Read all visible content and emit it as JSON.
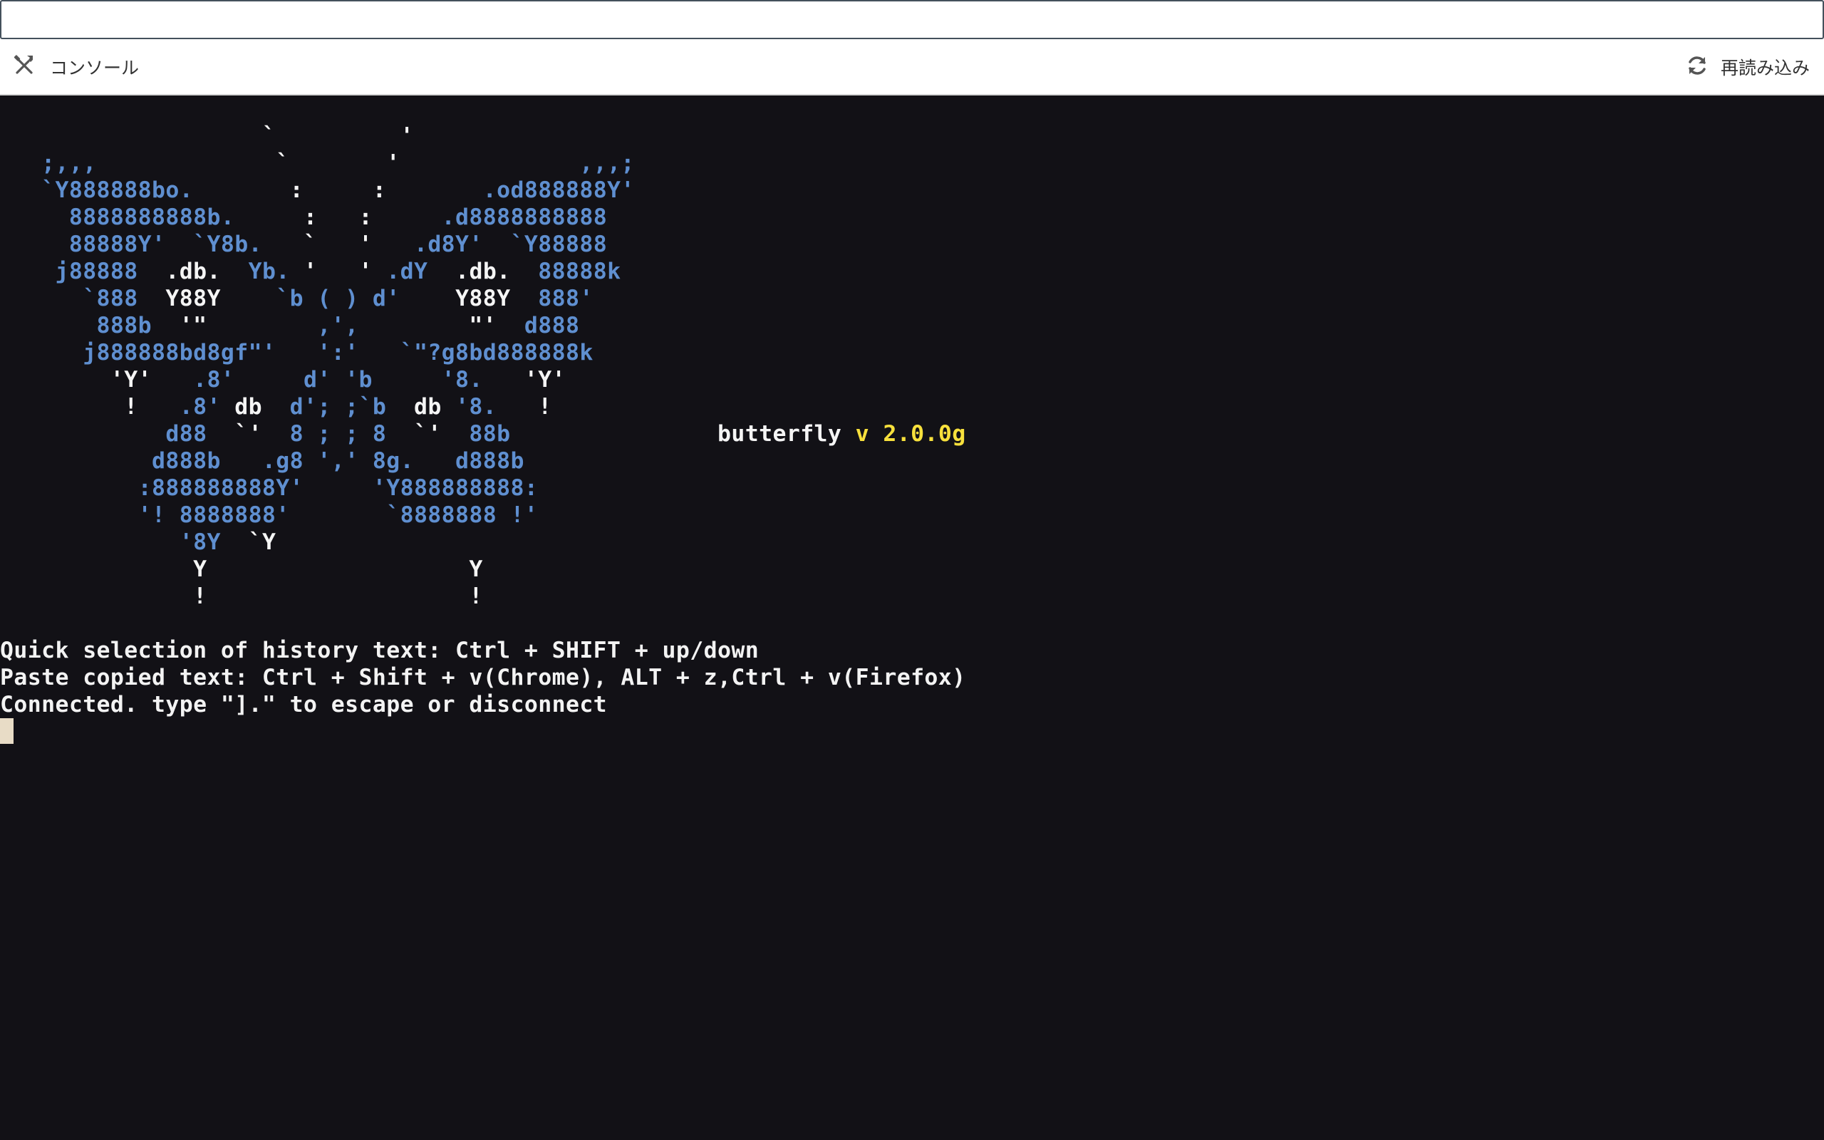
{
  "command_input": {
    "value": "",
    "placeholder": ""
  },
  "toolbar": {
    "console_label": "コンソール",
    "console_icon": "tools-icon",
    "reload_label": "再読み込み",
    "reload_icon": "refresh-icon"
  },
  "terminal": {
    "app_name": "butterfly",
    "version": "v 2.0.0g",
    "help_lines": [
      "Quick selection of history text: Ctrl + SHIFT + up/down",
      "Paste copied text: Ctrl + Shift + v(Chrome), ALT + z,Ctrl + v(Firefox)",
      "Connected. type \"].\" to escape or disconnect"
    ],
    "colors": {
      "background": "#121116",
      "butterfly_wing": "#5f8fd0",
      "text": "#f5f5f5",
      "version": "#f7e03c",
      "cursor": "#e8dcc6"
    }
  }
}
